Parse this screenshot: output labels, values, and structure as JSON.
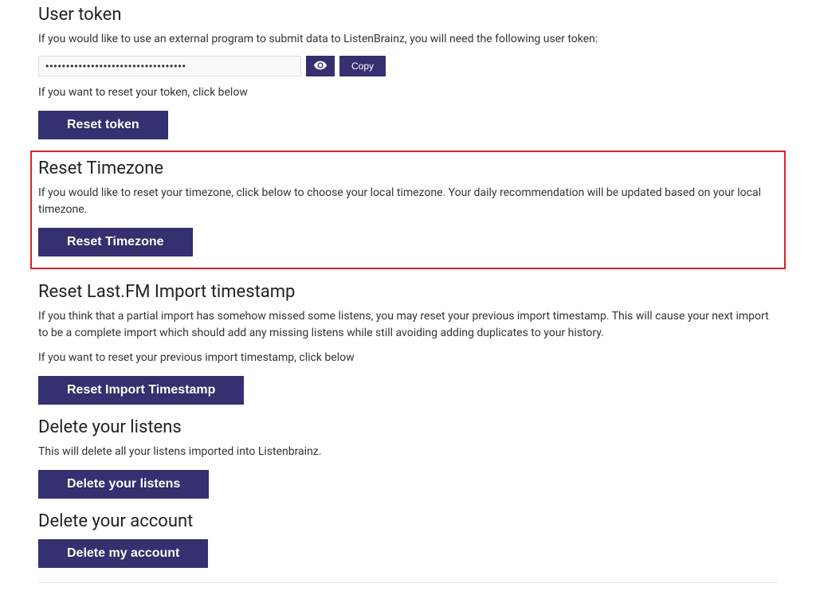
{
  "user_token": {
    "heading": "User token",
    "desc": "If you would like to use an external program to submit data to ListenBrainz, you will need the following user token:",
    "value": "••••••••••••••••••••••••••••••••••",
    "copy_label": "Copy",
    "reset_desc": "If you want to reset your token, click below",
    "reset_button": "Reset token"
  },
  "reset_timezone": {
    "heading": "Reset Timezone",
    "desc": "If you would like to reset your timezone, click below to choose your local timezone. Your daily recommendation will be updated based on your local timezone.",
    "button": "Reset Timezone"
  },
  "reset_lastfm": {
    "heading": "Reset Last.FM Import timestamp",
    "desc": "If you think that a partial import has somehow missed some listens, you may reset your previous import timestamp. This will cause your next import to be a complete import which should add any missing listens while still avoiding adding duplicates to your history.",
    "desc2": "If you want to reset your previous import timestamp, click below",
    "button": "Reset Import Timestamp"
  },
  "delete_listens": {
    "heading": "Delete your listens",
    "desc": "This will delete all your listens imported into Listenbrainz.",
    "button": "Delete your listens"
  },
  "delete_account": {
    "heading": "Delete your account",
    "button": "Delete my account"
  }
}
